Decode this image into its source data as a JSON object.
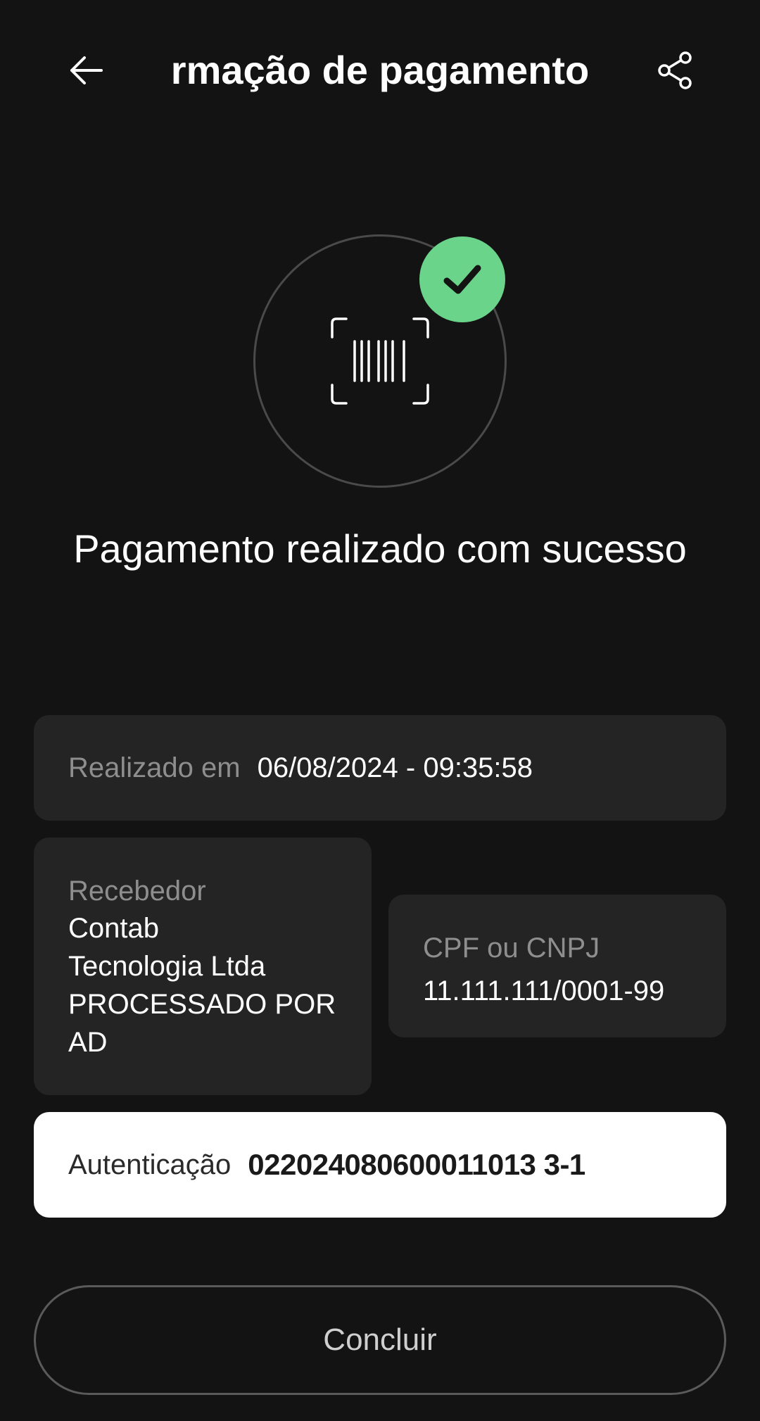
{
  "header": {
    "title": "rmação de pagamento",
    "back_icon": "arrow-left-icon",
    "share_icon": "share-icon"
  },
  "status": {
    "icon": "barcode-scan-icon",
    "badge_icon": "check-icon",
    "badge_color": "#6bd48b",
    "message": "Pagamento realizado com sucesso"
  },
  "details": {
    "date_label": "Realizado em",
    "date_value": "06/08/2024 - 09:35:58",
    "receiver_label": "Recebedor",
    "receiver_value": "Contab\nTecnologia Ltda\nPROCESSADO POR\nAD",
    "document_label": "CPF ou CNPJ",
    "document_value": "11.111.111/0001-99",
    "auth_label": "Autenticação",
    "auth_value": "022024080600011013 3-1"
  },
  "actions": {
    "done_label": "Concluir"
  }
}
